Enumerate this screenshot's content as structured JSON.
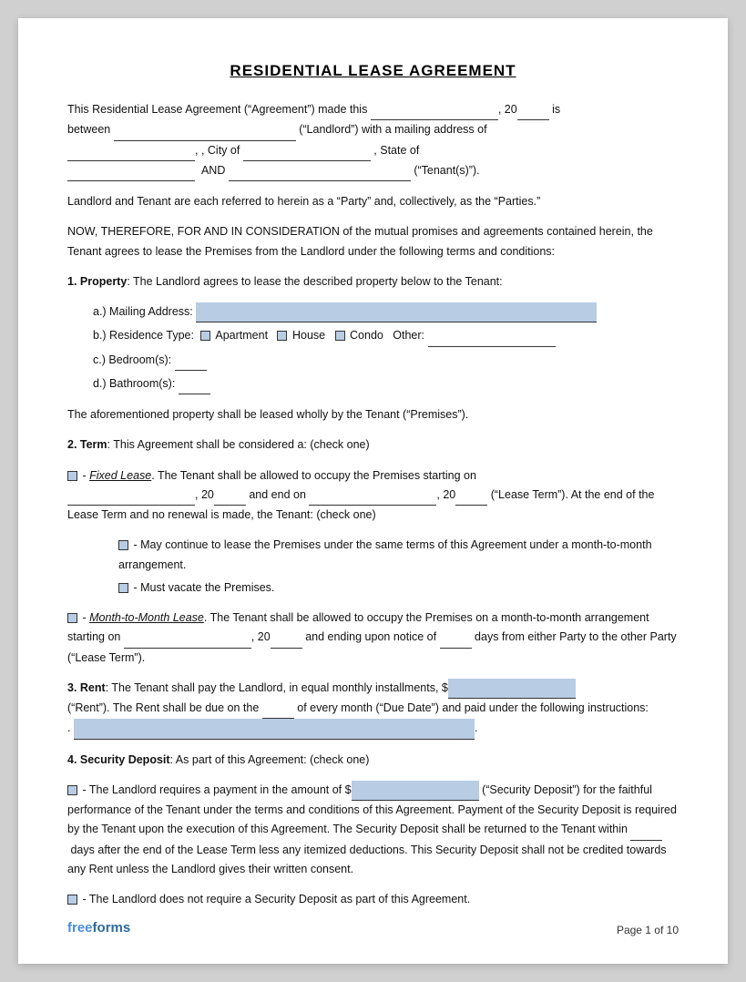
{
  "title": "RESIDENTIAL LEASE AGREEMENT",
  "intro": {
    "line1_pre": "This Residential Lease Agreement (“Agreement”) made this",
    "line1_mid": ", 20",
    "line1_post": "is",
    "line2_pre": "between",
    "line2_mid": "(“Landlord”) with a mailing address of",
    "line3_pre": "",
    "line3_mid": ", City of",
    "line3_post": ", State of",
    "line4_pre": "",
    "line4_and": "AND",
    "line4_post": "(“Tenant(s)”)."
  },
  "parties_text": "Landlord and Tenant are each referred to herein as a “Party” and, collectively, as the “Parties.”",
  "consideration_text": "NOW, THEREFORE, FOR AND IN CONSIDERATION of the mutual promises and agreements contained herein, the Tenant agrees to lease the Premises from the Landlord under the following terms and conditions:",
  "section1": {
    "heading": "1. Property",
    "text": ": The Landlord agrees to lease the described property below to the Tenant:",
    "a_label": "a.)  Mailing Address:",
    "b_label": "b.)  Residence Type:",
    "b_apartment": "Apartment",
    "b_house": "House",
    "b_condo": "Condo",
    "b_other": "Other:",
    "c_label": "c.)  Bedroom(s):",
    "d_label": "d.)  Bathroom(s):",
    "footer_text": "The aforementioned property shall be leased wholly by the Tenant (“Premises”)."
  },
  "section2": {
    "heading": "2. Term",
    "text": ": This Agreement shall be considered a: (check one)",
    "fixed_label": "- ",
    "fixed_name": "Fixed Lease",
    "fixed_text1": ". The Tenant shall be allowed to occupy the Premises starting on",
    "fixed_text2": ", 20",
    "fixed_text3": "and end on",
    "fixed_text4": ", 20",
    "fixed_text5": "(“Lease Term”). At the end of the Lease Term and no renewal is made, the Tenant: (check one)",
    "sub1_text": "- May continue to lease the Premises under the same terms of this Agreement under a month-to-month arrangement.",
    "sub2_text": "- Must vacate the Premises.",
    "mtm_label": "- ",
    "mtm_name": "Month-to-Month Lease",
    "mtm_text1": ". The Tenant shall be allowed to occupy the Premises on a month-to-month arrangement starting on",
    "mtm_text2": ", 20",
    "mtm_text3": "and ending upon notice of",
    "mtm_text4": "days from either Party to the other Party (“Lease Term”)."
  },
  "section3": {
    "heading": "3. Rent",
    "text1": ": The Tenant shall pay the Landlord, in equal monthly installments, $",
    "text2": "(“Rent”). The Rent shall be due on the",
    "text3": "of every month (“Due Date”) and paid under the following instructions:",
    "text4": "."
  },
  "section4": {
    "heading": "4. Security Deposit",
    "text": ": As part of this Agreement: (check one)",
    "option1_pre": "- The Landlord requires a payment in the amount of $",
    "option1_mid": "(“Security Deposit”) for the faithful performance of the Tenant under the terms and conditions of this Agreement. Payment of the Security Deposit is required by the Tenant upon the execution of this Agreement. The Security Deposit shall be returned to the Tenant within",
    "option1_days": "days after the end of the Lease Term less any itemized deductions. This Security Deposit shall not be credited towards any Rent unless the Landlord gives their written consent.",
    "option2": "- The Landlord does not require a Security Deposit as part of this Agreement."
  },
  "footer": {
    "logo_free": "free",
    "logo_forms": "forms",
    "page": "Page 1 of 10"
  }
}
